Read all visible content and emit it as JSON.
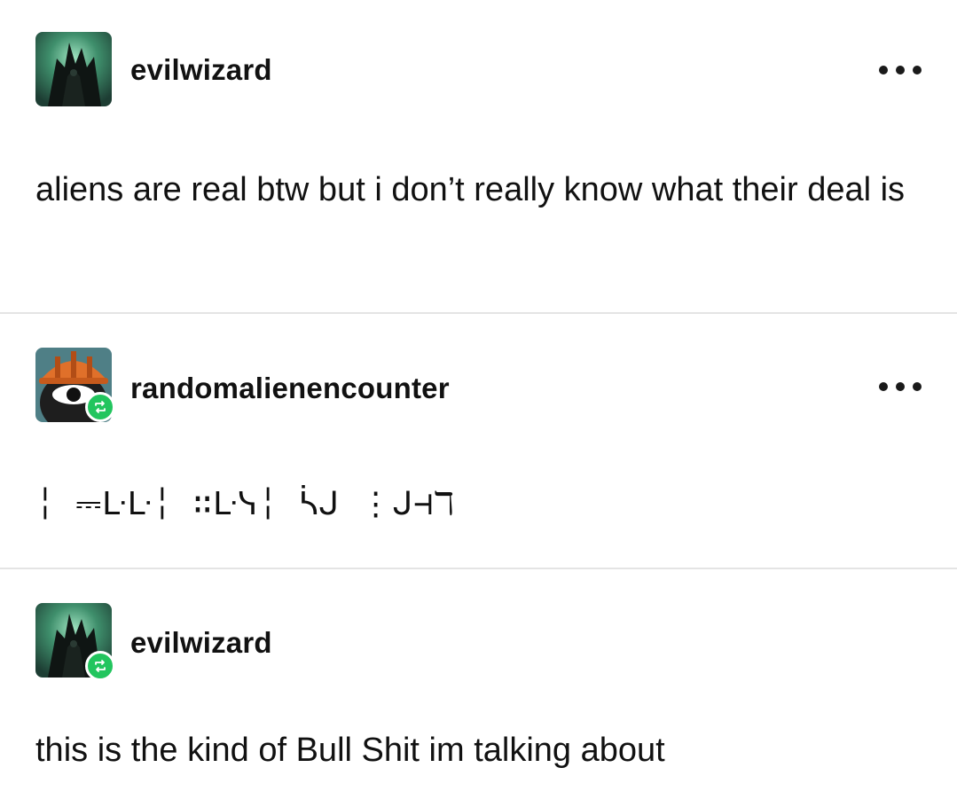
{
  "colors": {
    "reblog_green": "#22c55e",
    "divider": "#e4e4e4",
    "text": "#111111"
  },
  "posts": [
    {
      "username": "evilwizard",
      "avatar_icon": "wizard-avatar-icon",
      "reblogged": false,
      "show_menu": true,
      "text": "aliens are real btw but i don’t really know what their deal is"
    },
    {
      "username": "randomalienencounter",
      "avatar_icon": "alien-hardhat-avatar-icon",
      "reblogged": true,
      "show_menu": true,
      "text": "╎ ⎓ᒷᒷ╎ ∷ᒷᓭ╎ ᓵᒍ ⋮ᒍ⊣ℸ"
    },
    {
      "username": "evilwizard",
      "avatar_icon": "wizard-avatar-icon",
      "reblogged": true,
      "show_menu": false,
      "text": "this is the kind of Bull Shit im talking about"
    }
  ]
}
